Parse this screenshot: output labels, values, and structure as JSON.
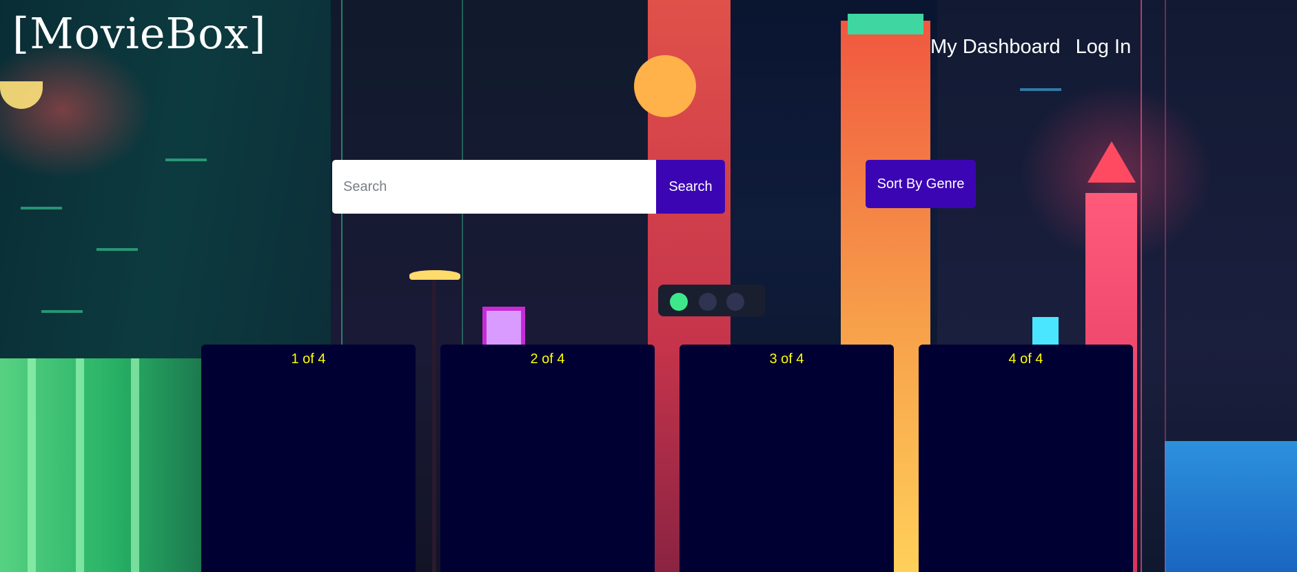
{
  "brand": {
    "logo_text": "[MovieBox]"
  },
  "nav": {
    "items": [
      {
        "label": "My Dashboard"
      },
      {
        "label": "Log In"
      }
    ]
  },
  "search": {
    "placeholder": "Search",
    "value": "",
    "button_label": "Search"
  },
  "sort": {
    "button_label": "Sort By Genre"
  },
  "cards": [
    {
      "counter": "1 of 4"
    },
    {
      "counter": "2 of 4"
    },
    {
      "counter": "3 of 4"
    },
    {
      "counter": "4 of 4"
    }
  ],
  "colors": {
    "button_bg": "#3c05b4",
    "card_bg": "#000033",
    "counter_text": "#ffff00",
    "nav_text": "#ffffff"
  }
}
